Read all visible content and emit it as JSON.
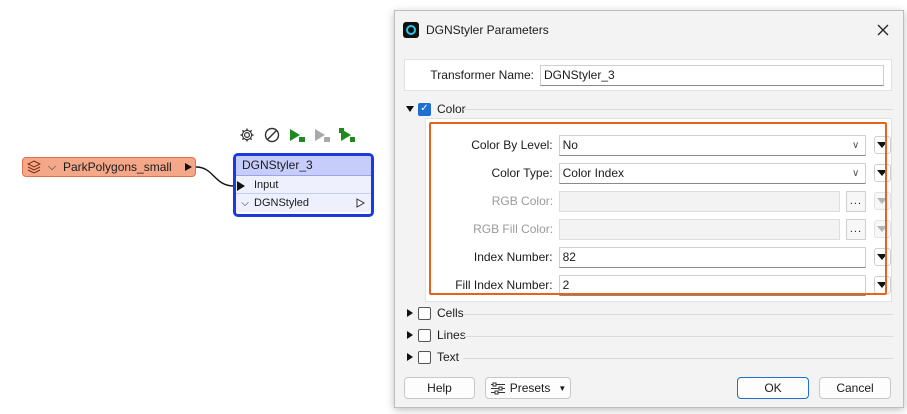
{
  "canvas": {
    "reader": {
      "label": "ParkPolygons_small",
      "icon": "layers-icon"
    },
    "transformer": {
      "title": "DGNStyler_3",
      "input_port": "Input",
      "output_port": "DGNStyled"
    },
    "toolbar": [
      "gear-icon",
      "disable-icon",
      "run-to-this-icon",
      "run-partial-icon",
      "run-from-this-icon"
    ]
  },
  "dialog": {
    "title": "DGNStyler Parameters",
    "transformer_name_label": "Transformer Name:",
    "transformer_name_value": "DGNStyler_3",
    "sections": {
      "color": {
        "label": "Color",
        "checked": true,
        "expanded": true
      },
      "cells": {
        "label": "Cells",
        "checked": false,
        "expanded": false
      },
      "lines": {
        "label": "Lines",
        "checked": false,
        "expanded": false
      },
      "text": {
        "label": "Text",
        "checked": false,
        "expanded": false
      }
    },
    "color_params": [
      {
        "label": "Color By Level:",
        "value": "No",
        "type": "combo",
        "enabled": true
      },
      {
        "label": "Color Type:",
        "value": "Color Index",
        "type": "combo",
        "enabled": true
      },
      {
        "label": "RGB Color:",
        "value": "",
        "type": "picker",
        "enabled": false
      },
      {
        "label": "RGB Fill Color:",
        "value": "",
        "type": "picker",
        "enabled": false
      },
      {
        "label": "Index Number:",
        "value": "82",
        "type": "text",
        "enabled": true
      },
      {
        "label": "Fill Index Number:",
        "value": "2",
        "type": "text",
        "enabled": true
      }
    ],
    "ellipsis": "...",
    "buttons": {
      "help": "Help",
      "presets": "Presets",
      "ok": "OK",
      "cancel": "Cancel"
    },
    "highlight_color": "#e8621c",
    "accent_color": "#1f6fd1"
  }
}
